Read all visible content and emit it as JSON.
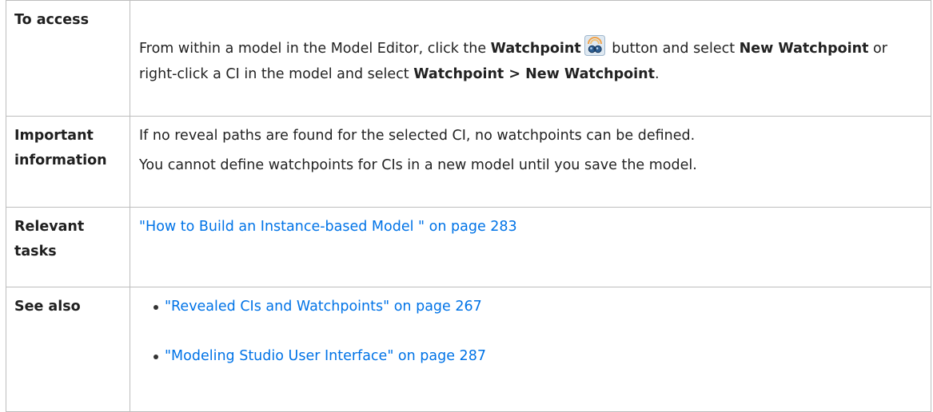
{
  "rows": {
    "access": {
      "label": "To access",
      "t1": "From within a model in the Model Editor, click the ",
      "b1": "Watchpoint",
      "t2": " button and select ",
      "b2": "New Watchpoint",
      "t3": " or right-click a CI in the model and select ",
      "b3": "Watchpoint > New Watchpoint",
      "t4": ".",
      "icon": "watchpoint-icon"
    },
    "important": {
      "label": "Important information",
      "p1": "If no reveal paths are found for the selected CI, no watchpoints can be defined.",
      "p2": "You cannot define watchpoints for CIs in a new model until you save the model."
    },
    "tasks": {
      "label": "Relevant tasks",
      "link": "\"How to Build an Instance-based Model \" on page 283"
    },
    "see_also": {
      "label": "See also",
      "links": [
        "\"Revealed CIs and Watchpoints\" on page 267",
        "\"Modeling Studio User Interface\" on page 287"
      ]
    }
  },
  "colors": {
    "link": "#0073e7",
    "border": "#bdbdbd",
    "text": "#222222"
  }
}
